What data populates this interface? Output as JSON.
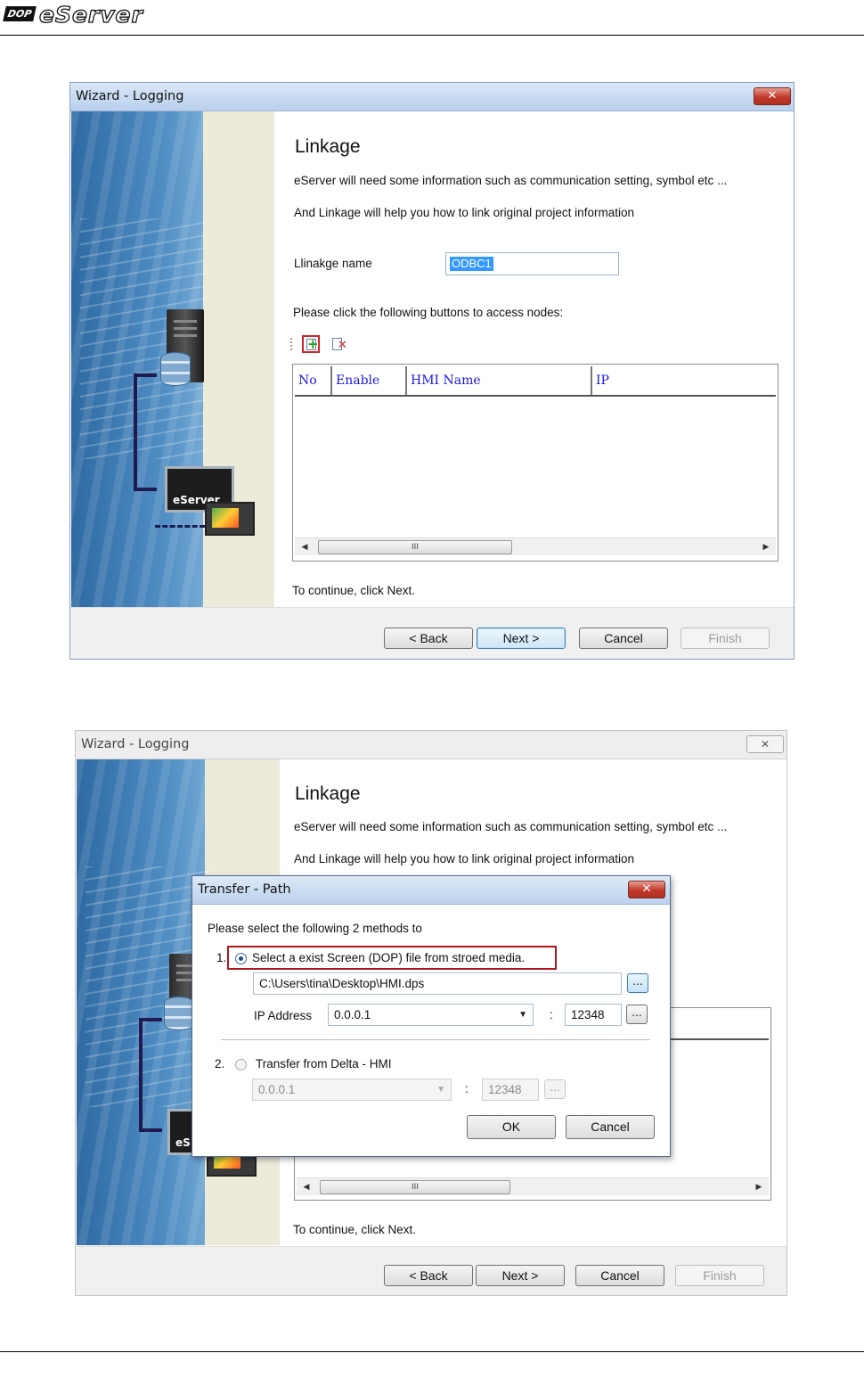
{
  "header": {
    "brand_badge": "DOP",
    "brand_name": "eServer"
  },
  "wizard1": {
    "title": "Wizard - Logging",
    "close_glyph": "✕",
    "heading": "Linkage",
    "desc_line1": "eServer will need some information such as communication setting, symbol etc ...",
    "desc_line2": "And Linkage will help you how to link original project information",
    "name_label": "Llinakge name",
    "name_value": "ODBC1",
    "nodes_prompt": "Please click the following buttons to access nodes:",
    "columns": [
      "No",
      "Enable",
      "HMI Name",
      "IP"
    ],
    "scroll_left": "◀",
    "scroll_right": "▶",
    "scroll_thumb": "III",
    "continue_text": "To continue, click Next.",
    "buttons": {
      "back": "< Back",
      "next": "Next >",
      "cancel": "Cancel",
      "finish": "Finish"
    },
    "art_label": "eServer"
  },
  "wizard2": {
    "title": "Wizard - Logging",
    "close_glyph": "✕",
    "heading": "Linkage",
    "desc_line1": "eServer will need some information such as communication setting, symbol etc ...",
    "desc_line2": "And Linkage will help you how to link original project information",
    "scroll_left": "◀",
    "scroll_right": "▶",
    "scroll_thumb": "III",
    "continue_text": "To continue, click Next.",
    "buttons": {
      "back": "< Back",
      "next": "Next >",
      "cancel": "Cancel",
      "finish": "Finish"
    },
    "art_label": "eS"
  },
  "transfer_dialog": {
    "title": "Transfer - Path",
    "close_glyph": "✕",
    "instruction": "Please select the following 2 methods to",
    "option1_number": "1.",
    "option1_label": "Select a exist  Screen (DOP) file from stroed media.",
    "file_path": "C:\\Users\\tina\\Desktop\\HMI.dps",
    "browse_label": "...",
    "ip_label": "IP Address",
    "ip_value": "0.0.0.1",
    "port_separator": ":",
    "port_value": "12348",
    "option2_number": "2.",
    "option2_label": "Transfer from Delta - HMI",
    "option2_ip_value": "0.0.0.1",
    "option2_port_value": "12348",
    "ok_label": "OK",
    "cancel_label": "Cancel",
    "selected_option": 1
  },
  "colors": {
    "highlight_red": "#b0161d",
    "selection_blue": "#3399ff",
    "column_header_text": "#1a1adb"
  }
}
